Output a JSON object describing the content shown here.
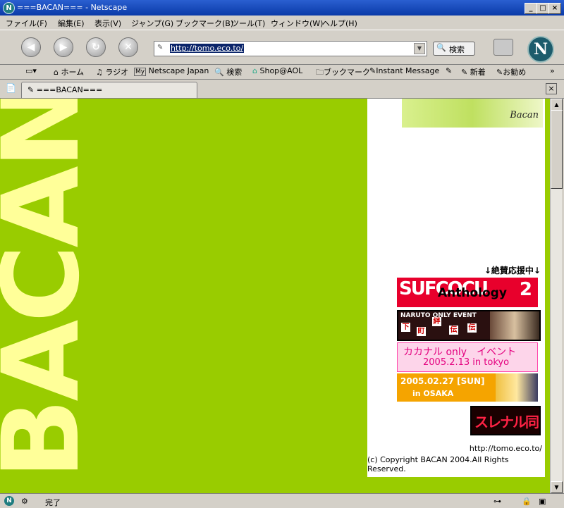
{
  "window": {
    "title": "===BACAN=== - Netscape",
    "app_icon_letter": "N"
  },
  "menu": [
    "ファイル(F)",
    "編集(E)",
    "表示(V)",
    "ジャンプ(G)",
    "ブックマーク(B)",
    "ツール(T)",
    "ウィンドウ(W)",
    "ヘルプ(H)"
  ],
  "nav": {
    "url": "http://tomo.eco.to/",
    "search_label": "検索"
  },
  "personal": {
    "home": "ホーム",
    "radio": "ラジオ",
    "my_badge": "My",
    "netscape_japan": "Netscape Japan",
    "search": "検索",
    "shop": "Shop@AOL",
    "bookmarks": "ブックマーク",
    "instant_message": "Instant Message",
    "new_arrivals": "新着",
    "recommend": "お勧め"
  },
  "tab": {
    "title": "===BACAN==="
  },
  "page": {
    "big_title": "BACAN",
    "top_image_text": "Bacan",
    "support_heading": "↓絶賛応援中↓",
    "banners": {
      "b1_left": "SUFCOCU",
      "b1_mid": "Anthology",
      "b1_num": "2",
      "b2_line1": "NARUTO ONLY EVENT",
      "b2_kanji": [
        "下",
        "町",
        "絆",
        "伝",
        "伝"
      ],
      "b3_line1": "カカナル only　イベント",
      "b3_line2": "2005.2.13 in tokyo",
      "b4_line1": "2005.02.27 [SUN]",
      "b4_line2": "in OSAKA",
      "b5_text": "スレナル同盟"
    },
    "footer_url": "http://tomo.eco.to/",
    "copyright": "(c) Copyright BACAN 2004.All Rights Reserved."
  },
  "status": {
    "text": "完了"
  }
}
